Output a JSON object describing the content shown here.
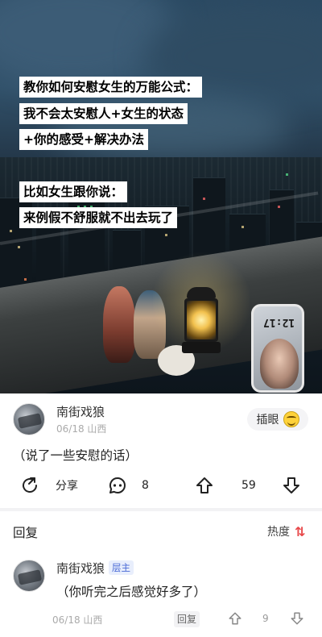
{
  "image": {
    "captions": [
      "教你如何安慰女生的万能公式：",
      "我不会太安慰人+女生的状态",
      "+你的感受+解决办法",
      "比如女生跟你说：",
      "来例假不舒服就不出去玩了"
    ],
    "phone_time": "12:17"
  },
  "post": {
    "author": "南街戏狼",
    "date": "06/18",
    "location": "山西",
    "follow_label": "插眼",
    "text": "（说了一些安慰的话）",
    "share_label": "分享",
    "comment_count": "8",
    "upvote_count": "59"
  },
  "replies": {
    "header": "回复",
    "sort_label": "热度",
    "sort_icon": "⇅",
    "items": [
      {
        "author": "南街戏狼",
        "badge": "层主",
        "text": "（你听完之后感觉好多了）",
        "date": "06/18",
        "location": "山西",
        "reply_label": "回复",
        "upvote_count": "9"
      }
    ]
  },
  "colors": {
    "accent_red": "#e8484a",
    "badge_blue": "#4a6ad6",
    "muted": "#aaaaaa"
  }
}
